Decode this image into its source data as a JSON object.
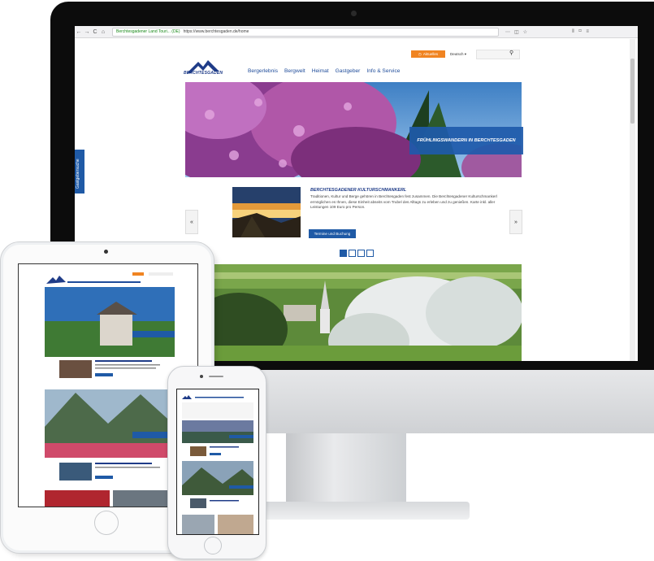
{
  "browser": {
    "back": "←",
    "forward": "→",
    "reload": "C",
    "home": "⌂",
    "site_identity": "Berchtesgadener Land Touri... (DE)",
    "url": "https://www.berchtesgaden.de/home",
    "icons": [
      "page-icon",
      "more-icon",
      "pocket-icon",
      "bookmark-star-icon",
      "library-icon",
      "sidebar-icon",
      "menu-icon"
    ]
  },
  "site": {
    "brand": "BERCHTESGADEN",
    "topbar": {
      "cta": "Aktuelles",
      "language": "Deutsch ▾",
      "search_icon": "search-icon"
    },
    "nav": [
      "Bergerlebnis",
      "Bergwelt",
      "Heimat",
      "Gastgeber",
      "Info & Service"
    ],
    "hero_caption": "FRÜHLINGSWANDERN IN BERCHTESGADEN",
    "side_tab": "Gastgebersuche",
    "teaser": {
      "title": "BERCHTESGADENER KULTURSCHMANKERL",
      "body": "Traditionen, Kultur und Berge gehören in Berchtesgaden fest zusammen. Die Berchtesgadener Kulturschmankerl ermöglichen es Ihnen, diese Einheit abseits vom Trubel des Alltags zu erleben und zu genießen. Karte inkl. aller Leistungen 109 Euro pro Person.",
      "button": "Termine und Buchung",
      "prev": "«",
      "next": "»"
    },
    "slider_dots": 4,
    "slider_active": 1
  },
  "colors": {
    "brand_blue": "#1f5aa6",
    "accent_orange": "#f08422"
  }
}
